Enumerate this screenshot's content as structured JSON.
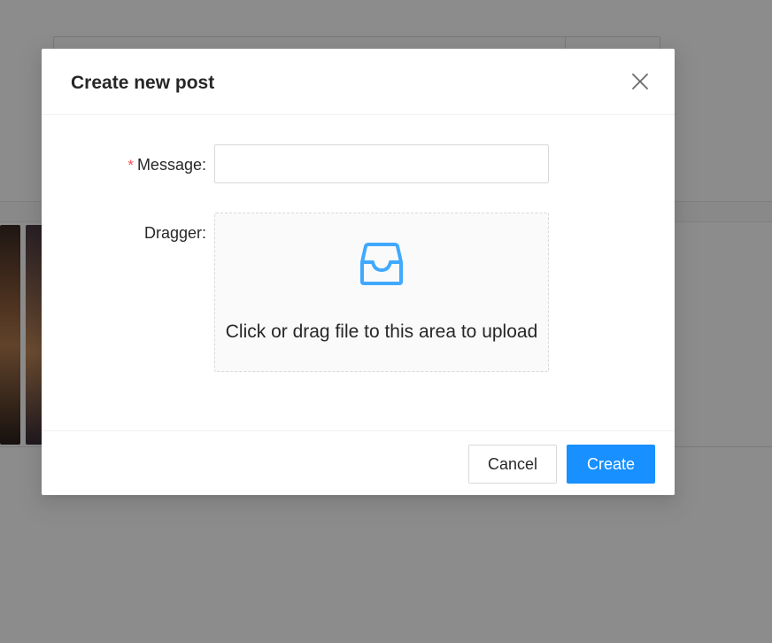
{
  "modal": {
    "title": "Create new post",
    "close_icon": "close-icon"
  },
  "form": {
    "message": {
      "required_mark": "*",
      "label": "Message",
      "colon": ":",
      "value": "",
      "placeholder": ""
    },
    "dragger": {
      "label": "Dragger",
      "colon": ":",
      "icon": "inbox-icon",
      "text": "Click or drag file to this area to upload"
    }
  },
  "footer": {
    "cancel_label": "Cancel",
    "create_label": "Create"
  },
  "colors": {
    "primary": "#1890ff",
    "required": "#ff4d4f",
    "mask": "rgba(0,0,0,0.45)"
  }
}
